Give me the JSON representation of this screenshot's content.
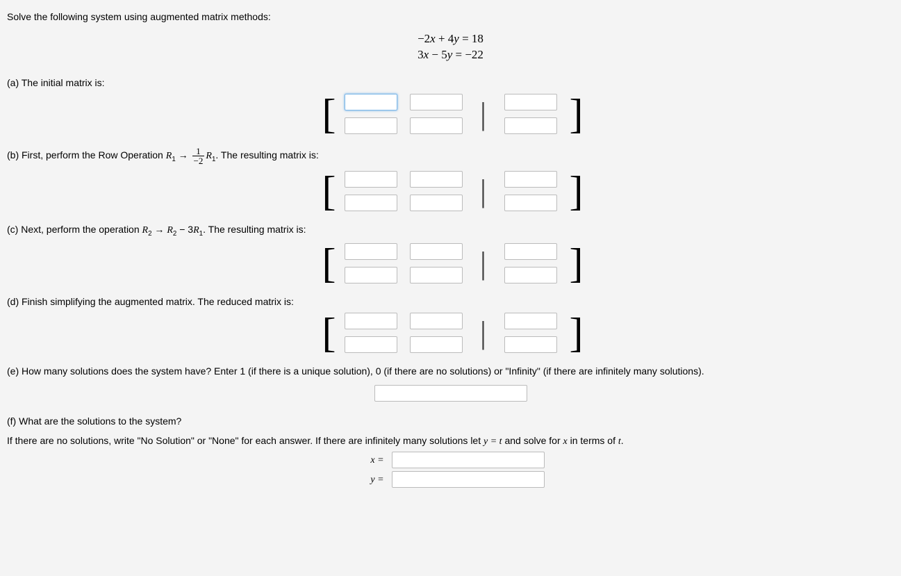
{
  "intro": "Solve the following system using augmented matrix methods:",
  "equations": {
    "line1": "−2x + 4y = 18",
    "line2": "3x − 5y = −22"
  },
  "parts": {
    "a": "(a) The initial matrix is:",
    "b_pre": "(b) First, perform the Row Operation ",
    "b_post": ". The resulting matrix is:",
    "b_op_lhs": "R",
    "b_op_lhs_sub": "1",
    "b_arrow": " → ",
    "b_frac_num": "1",
    "b_frac_den": "−2",
    "b_op_rhs": "R",
    "b_op_rhs_sub": "1",
    "c_pre": "(c) Next, perform the operation ",
    "c_post": ". The resulting matrix is:",
    "c_lhs": "R",
    "c_lhs_sub": "2",
    "c_arrow": " → ",
    "c_mid": "R",
    "c_mid_sub": "2",
    "c_minus": " − 3",
    "c_rhs": "R",
    "c_rhs_sub": "1",
    "d": "(d) Finish simplifying the augmented matrix. The reduced matrix is:",
    "e": "(e) How many solutions does the system have? Enter 1 (if there is a unique solution), 0 (if there are no solutions) or \"Infinity\" (if there are infinitely many solutions).",
    "f1": "(f) What are the solutions to the system?",
    "f2_pre": "If there are no solutions, write \"No Solution\" or \"None\" for each answer. If there are infinitely many solutions let ",
    "f2_mid": " and solve for ",
    "f2_post": " in terms of ",
    "f2_yt": "y = t",
    "f2_x": "x",
    "f2_t": "t",
    "f2_end": "."
  },
  "labels": {
    "x_eq": "x =",
    "y_eq": "y ="
  },
  "brackets": {
    "left": "[",
    "right": "]",
    "mid": "|"
  }
}
